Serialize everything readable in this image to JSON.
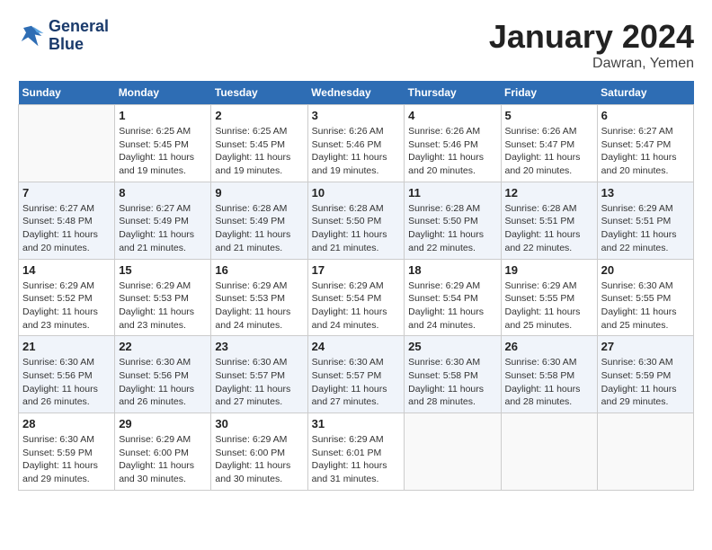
{
  "header": {
    "logo_line1": "General",
    "logo_line2": "Blue",
    "month_title": "January 2024",
    "location": "Dawran, Yemen"
  },
  "weekdays": [
    "Sunday",
    "Monday",
    "Tuesday",
    "Wednesday",
    "Thursday",
    "Friday",
    "Saturday"
  ],
  "weeks": [
    [
      {
        "day": "",
        "sunrise": "",
        "sunset": "",
        "daylight": ""
      },
      {
        "day": "1",
        "sunrise": "Sunrise: 6:25 AM",
        "sunset": "Sunset: 5:45 PM",
        "daylight": "Daylight: 11 hours and 19 minutes."
      },
      {
        "day": "2",
        "sunrise": "Sunrise: 6:25 AM",
        "sunset": "Sunset: 5:45 PM",
        "daylight": "Daylight: 11 hours and 19 minutes."
      },
      {
        "day": "3",
        "sunrise": "Sunrise: 6:26 AM",
        "sunset": "Sunset: 5:46 PM",
        "daylight": "Daylight: 11 hours and 19 minutes."
      },
      {
        "day": "4",
        "sunrise": "Sunrise: 6:26 AM",
        "sunset": "Sunset: 5:46 PM",
        "daylight": "Daylight: 11 hours and 20 minutes."
      },
      {
        "day": "5",
        "sunrise": "Sunrise: 6:26 AM",
        "sunset": "Sunset: 5:47 PM",
        "daylight": "Daylight: 11 hours and 20 minutes."
      },
      {
        "day": "6",
        "sunrise": "Sunrise: 6:27 AM",
        "sunset": "Sunset: 5:47 PM",
        "daylight": "Daylight: 11 hours and 20 minutes."
      }
    ],
    [
      {
        "day": "7",
        "sunrise": "Sunrise: 6:27 AM",
        "sunset": "Sunset: 5:48 PM",
        "daylight": "Daylight: 11 hours and 20 minutes."
      },
      {
        "day": "8",
        "sunrise": "Sunrise: 6:27 AM",
        "sunset": "Sunset: 5:49 PM",
        "daylight": "Daylight: 11 hours and 21 minutes."
      },
      {
        "day": "9",
        "sunrise": "Sunrise: 6:28 AM",
        "sunset": "Sunset: 5:49 PM",
        "daylight": "Daylight: 11 hours and 21 minutes."
      },
      {
        "day": "10",
        "sunrise": "Sunrise: 6:28 AM",
        "sunset": "Sunset: 5:50 PM",
        "daylight": "Daylight: 11 hours and 21 minutes."
      },
      {
        "day": "11",
        "sunrise": "Sunrise: 6:28 AM",
        "sunset": "Sunset: 5:50 PM",
        "daylight": "Daylight: 11 hours and 22 minutes."
      },
      {
        "day": "12",
        "sunrise": "Sunrise: 6:28 AM",
        "sunset": "Sunset: 5:51 PM",
        "daylight": "Daylight: 11 hours and 22 minutes."
      },
      {
        "day": "13",
        "sunrise": "Sunrise: 6:29 AM",
        "sunset": "Sunset: 5:51 PM",
        "daylight": "Daylight: 11 hours and 22 minutes."
      }
    ],
    [
      {
        "day": "14",
        "sunrise": "Sunrise: 6:29 AM",
        "sunset": "Sunset: 5:52 PM",
        "daylight": "Daylight: 11 hours and 23 minutes."
      },
      {
        "day": "15",
        "sunrise": "Sunrise: 6:29 AM",
        "sunset": "Sunset: 5:53 PM",
        "daylight": "Daylight: 11 hours and 23 minutes."
      },
      {
        "day": "16",
        "sunrise": "Sunrise: 6:29 AM",
        "sunset": "Sunset: 5:53 PM",
        "daylight": "Daylight: 11 hours and 24 minutes."
      },
      {
        "day": "17",
        "sunrise": "Sunrise: 6:29 AM",
        "sunset": "Sunset: 5:54 PM",
        "daylight": "Daylight: 11 hours and 24 minutes."
      },
      {
        "day": "18",
        "sunrise": "Sunrise: 6:29 AM",
        "sunset": "Sunset: 5:54 PM",
        "daylight": "Daylight: 11 hours and 24 minutes."
      },
      {
        "day": "19",
        "sunrise": "Sunrise: 6:29 AM",
        "sunset": "Sunset: 5:55 PM",
        "daylight": "Daylight: 11 hours and 25 minutes."
      },
      {
        "day": "20",
        "sunrise": "Sunrise: 6:30 AM",
        "sunset": "Sunset: 5:55 PM",
        "daylight": "Daylight: 11 hours and 25 minutes."
      }
    ],
    [
      {
        "day": "21",
        "sunrise": "Sunrise: 6:30 AM",
        "sunset": "Sunset: 5:56 PM",
        "daylight": "Daylight: 11 hours and 26 minutes."
      },
      {
        "day": "22",
        "sunrise": "Sunrise: 6:30 AM",
        "sunset": "Sunset: 5:56 PM",
        "daylight": "Daylight: 11 hours and 26 minutes."
      },
      {
        "day": "23",
        "sunrise": "Sunrise: 6:30 AM",
        "sunset": "Sunset: 5:57 PM",
        "daylight": "Daylight: 11 hours and 27 minutes."
      },
      {
        "day": "24",
        "sunrise": "Sunrise: 6:30 AM",
        "sunset": "Sunset: 5:57 PM",
        "daylight": "Daylight: 11 hours and 27 minutes."
      },
      {
        "day": "25",
        "sunrise": "Sunrise: 6:30 AM",
        "sunset": "Sunset: 5:58 PM",
        "daylight": "Daylight: 11 hours and 28 minutes."
      },
      {
        "day": "26",
        "sunrise": "Sunrise: 6:30 AM",
        "sunset": "Sunset: 5:58 PM",
        "daylight": "Daylight: 11 hours and 28 minutes."
      },
      {
        "day": "27",
        "sunrise": "Sunrise: 6:30 AM",
        "sunset": "Sunset: 5:59 PM",
        "daylight": "Daylight: 11 hours and 29 minutes."
      }
    ],
    [
      {
        "day": "28",
        "sunrise": "Sunrise: 6:30 AM",
        "sunset": "Sunset: 5:59 PM",
        "daylight": "Daylight: 11 hours and 29 minutes."
      },
      {
        "day": "29",
        "sunrise": "Sunrise: 6:29 AM",
        "sunset": "Sunset: 6:00 PM",
        "daylight": "Daylight: 11 hours and 30 minutes."
      },
      {
        "day": "30",
        "sunrise": "Sunrise: 6:29 AM",
        "sunset": "Sunset: 6:00 PM",
        "daylight": "Daylight: 11 hours and 30 minutes."
      },
      {
        "day": "31",
        "sunrise": "Sunrise: 6:29 AM",
        "sunset": "Sunset: 6:01 PM",
        "daylight": "Daylight: 11 hours and 31 minutes."
      },
      {
        "day": "",
        "sunrise": "",
        "sunset": "",
        "daylight": ""
      },
      {
        "day": "",
        "sunrise": "",
        "sunset": "",
        "daylight": ""
      },
      {
        "day": "",
        "sunrise": "",
        "sunset": "",
        "daylight": ""
      }
    ]
  ]
}
